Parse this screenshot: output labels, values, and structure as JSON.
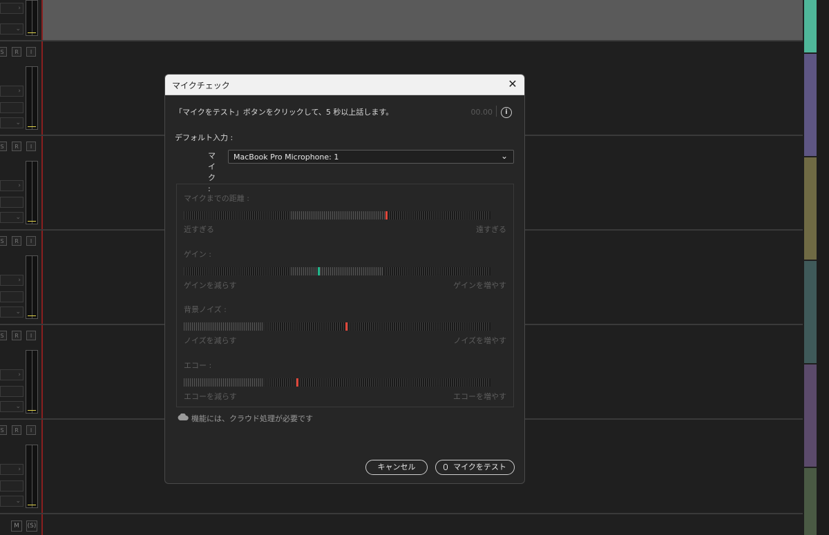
{
  "background": {
    "side_strip_colors": [
      "#4fb79a",
      "#5e5684",
      "#6f6a44",
      "#3f5a5a",
      "#5b4a6b",
      "#4a5a44"
    ],
    "track_buttons": [
      "S",
      "R",
      "I"
    ],
    "bottom_buttons": [
      "M",
      "(S)"
    ]
  },
  "dialog": {
    "title": "マイクチェック",
    "close_icon": "close-icon",
    "instruction": "「マイクをテスト」ボタンをクリックして、5 秒以上話します。",
    "timer": "00.00",
    "info_icon": "info-icon",
    "default_input_label": "デフォルト入力 :",
    "mic_label": "マイク :",
    "mic_value": "MacBook Pro Microphone: 1",
    "meters": [
      {
        "title": "マイクまでの距離 :",
        "left_label": "近すぎる",
        "right_label": "遠すぎる",
        "level": 0.66,
        "marker_color": "#e0463a",
        "range": [
          0.35,
          0.66
        ]
      },
      {
        "title": "ゲイン :",
        "left_label": "ゲインを減らす",
        "right_label": "ゲインを増やす",
        "level": 0.44,
        "marker_color": "#1fb58a",
        "range": [
          0.35,
          0.65
        ]
      },
      {
        "title": "背景ノイズ :",
        "left_label": "ノイズを減らす",
        "right_label": "ノイズを増やす",
        "level": 0.53,
        "marker_color": "#e0463a",
        "range": [
          0.0,
          0.26
        ]
      },
      {
        "title": "エコー :",
        "left_label": "エコーを減らす",
        "right_label": "エコーを増やす",
        "level": 0.37,
        "marker_color": "#e0463a",
        "range": [
          0.0,
          0.26
        ]
      }
    ],
    "cloud_note": "機能には、クラウド処理が必要です",
    "cancel_label": "キャンセル",
    "test_label": "マイクをテスト",
    "accent_marker_red": "#e0463a",
    "accent_marker_green": "#1fb58a"
  }
}
